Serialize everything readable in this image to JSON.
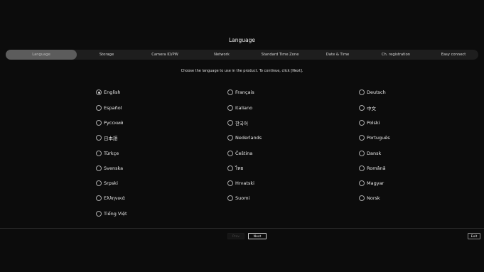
{
  "page": {
    "title": "Language"
  },
  "tabs": [
    {
      "label": "Language",
      "active": true
    },
    {
      "label": "Storage"
    },
    {
      "label": "Camera ID/PW"
    },
    {
      "label": "Network"
    },
    {
      "label": "Standard Time Zone"
    },
    {
      "label": "Date & Time"
    },
    {
      "label": "Ch. registration"
    },
    {
      "label": "Easy connect"
    }
  ],
  "instruction": "Choose the language to use in the product. To continue, click [Next].",
  "languages": [
    {
      "label": "English",
      "selected": true
    },
    {
      "label": "Français"
    },
    {
      "label": "Deutsch"
    },
    {
      "label": "Español"
    },
    {
      "label": "Italiano"
    },
    {
      "label": "中文"
    },
    {
      "label": "Русский"
    },
    {
      "label": "한국어"
    },
    {
      "label": "Polski"
    },
    {
      "label": "日本語"
    },
    {
      "label": "Nederlands"
    },
    {
      "label": "Português"
    },
    {
      "label": "Türkçe"
    },
    {
      "label": "Čeština"
    },
    {
      "label": "Dansk"
    },
    {
      "label": "Svenska"
    },
    {
      "label": "ไทย"
    },
    {
      "label": "Română"
    },
    {
      "label": "Srpski"
    },
    {
      "label": "Hrvatski"
    },
    {
      "label": "Magyar"
    },
    {
      "label": "Ελληνικά"
    },
    {
      "label": "Suomi"
    },
    {
      "label": "Norsk"
    },
    {
      "label": "Tiếng Việt"
    }
  ],
  "buttons": {
    "prev": "Prev",
    "next": "Next",
    "exit": "Exit"
  },
  "colors": {
    "background": "#0c0c0c",
    "tab_bar": "#1e1e1e",
    "tab_active": "#5c5c5c"
  }
}
